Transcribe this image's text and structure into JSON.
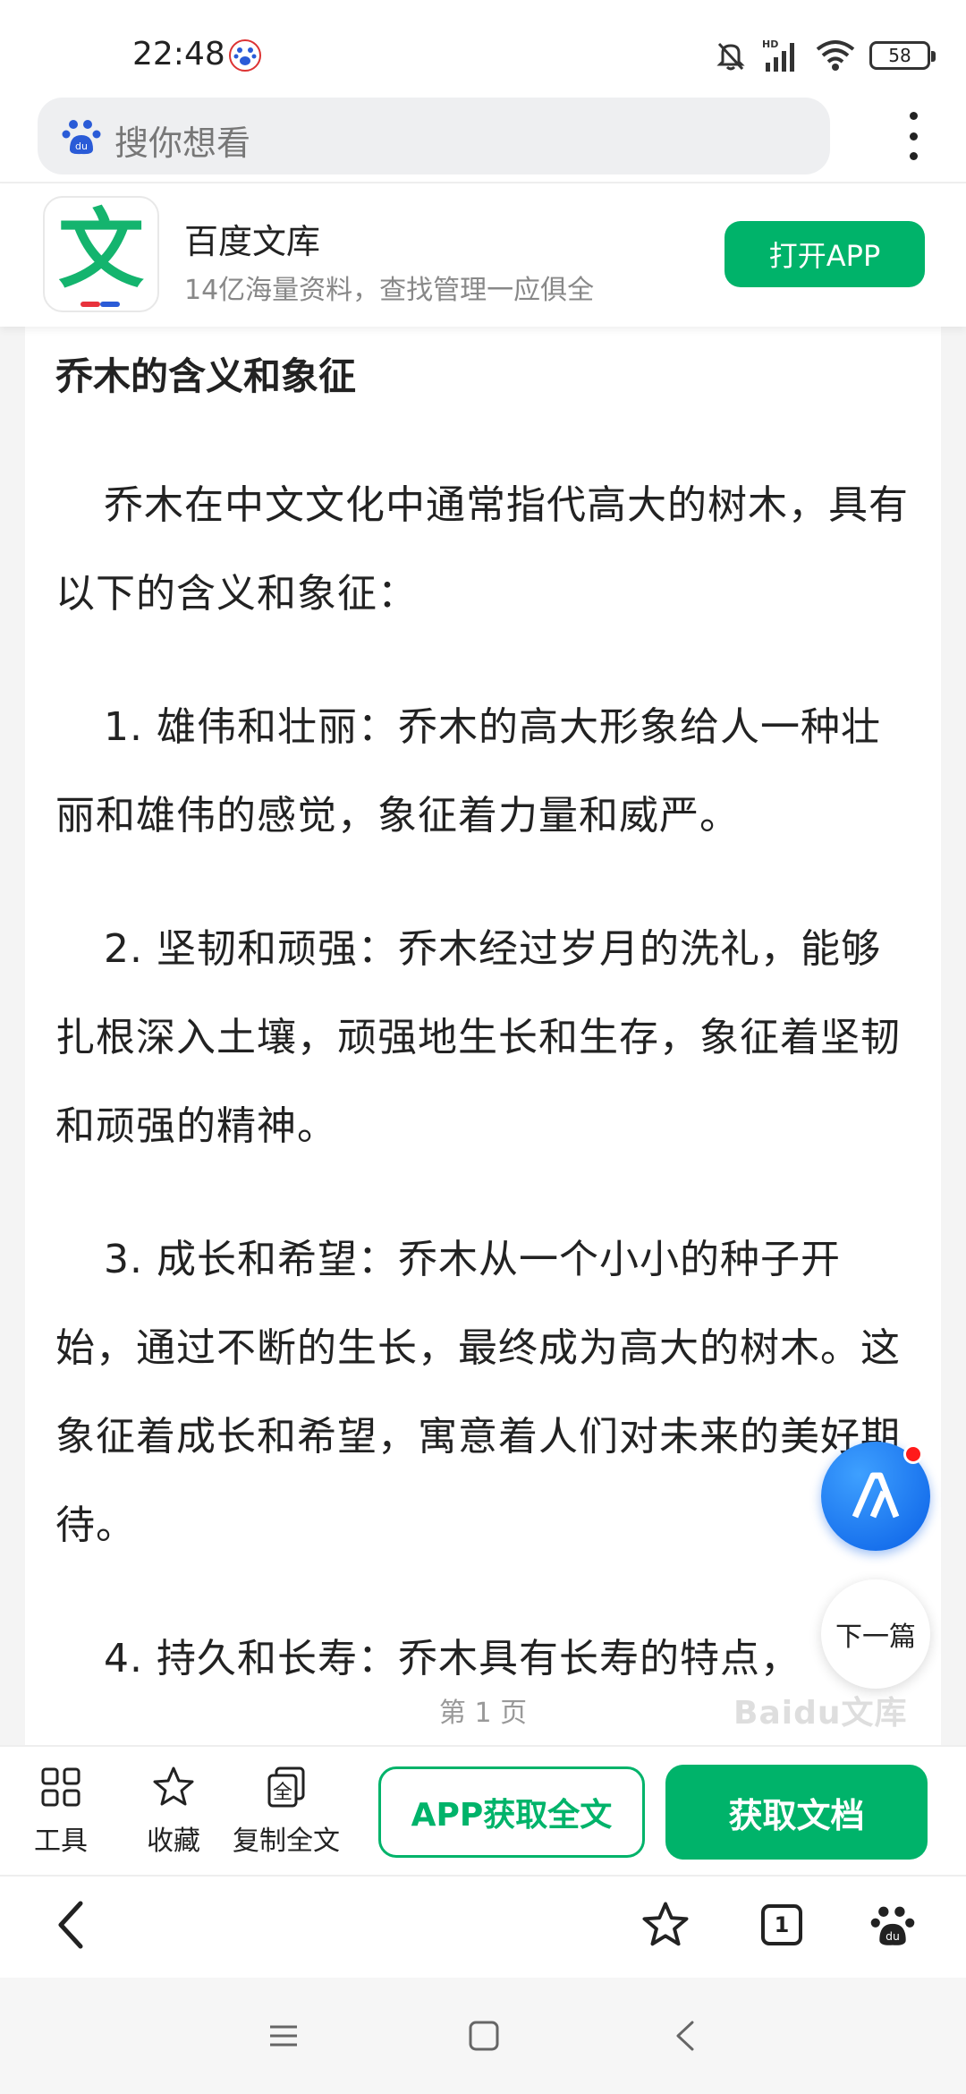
{
  "status_bar": {
    "time": "22:48",
    "battery": "58",
    "icons": [
      "baidu-app-icon",
      "bell-muted-icon",
      "hd-signal-icon",
      "wifi-icon",
      "battery-icon"
    ]
  },
  "search": {
    "placeholder": "搜你想看"
  },
  "app_banner": {
    "logo_char": "文",
    "name": "百度文库",
    "subtitle": "14亿海量资料，查找管理一应俱全",
    "open_button": "打开APP"
  },
  "document": {
    "title": "乔木的含义和象征",
    "paragraphs": [
      "乔木在中文文化中通常指代高大的树木，具有以下的含义和象征：",
      "1. 雄伟和壮丽：乔木的高大形象给人一种壮丽和雄伟的感觉，象征着力量和威严。",
      "2. 坚韧和顽强：乔木经过岁月的洗礼，能够扎根深入土壤，顽强地生长和生存，象征着坚韧和顽强的精神。",
      "3. 成长和希望：乔木从一个小小的种子开始，通过不断的生长，最终成为高大的树木。这象征着成长和希望，寓意着人们对未来的美好期待。",
      "4. 持久和长寿：乔木具有长寿的特点，"
    ],
    "page_indicator": "第 1 页",
    "watermark": "Baidu文库"
  },
  "floating": {
    "next_label": "下一篇"
  },
  "toolbar": {
    "tools_label": "工具",
    "favorite_label": "收藏",
    "copy_label": "复制全文",
    "app_full_text": "APP获取全文",
    "get_doc": "获取文档"
  },
  "browser_nav": {
    "tab_count": "1"
  },
  "colors": {
    "accent_green": "#00b36a",
    "ai_blue": "#0a60e6"
  }
}
